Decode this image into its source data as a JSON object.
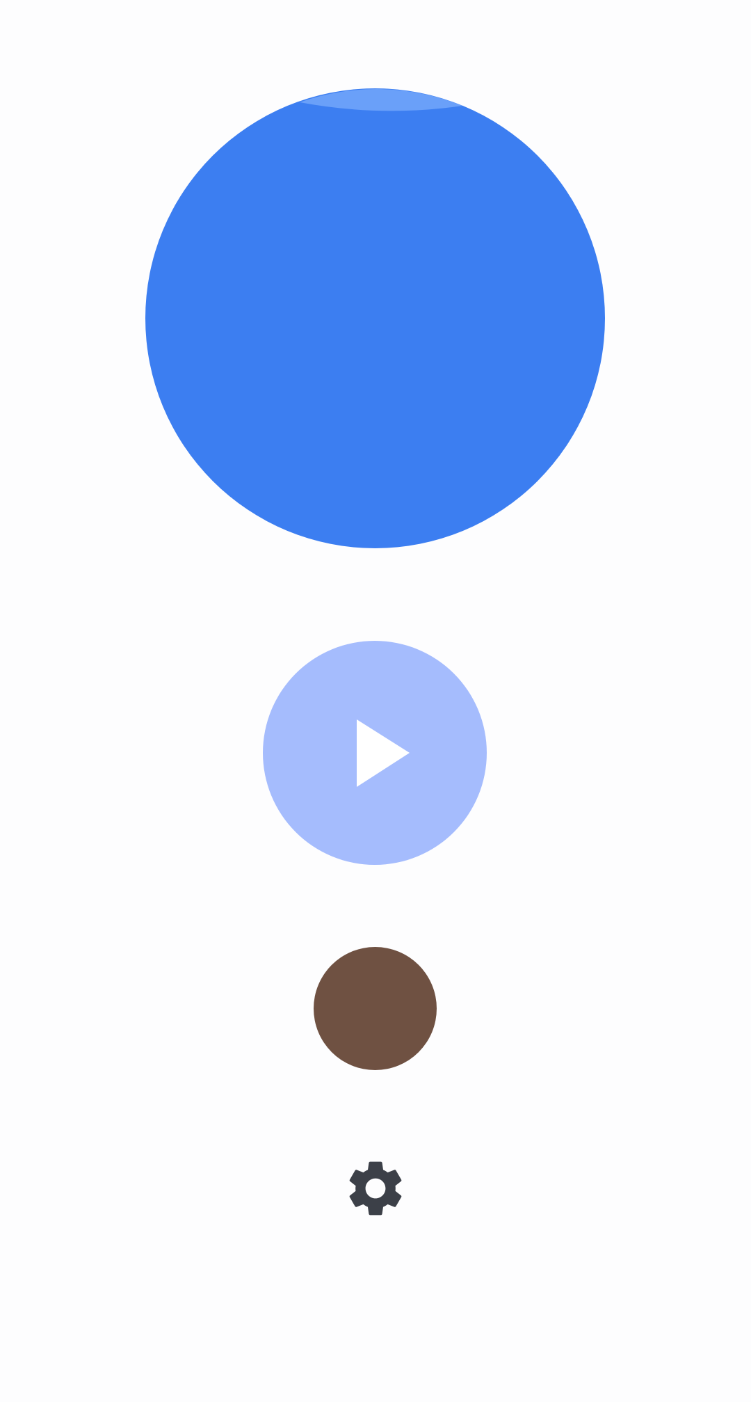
{
  "colors": {
    "background": "#fdfdfe",
    "primary_circle": "#3c7ef1",
    "primary_highlight": "#6aa0f9",
    "play_button_fill": "#a5bcfd",
    "play_icon": "#ffffff",
    "secondary_circle": "#6f5142",
    "settings_icon": "#3c4048"
  },
  "icons": {
    "play": "play-icon",
    "settings": "gear-icon"
  }
}
